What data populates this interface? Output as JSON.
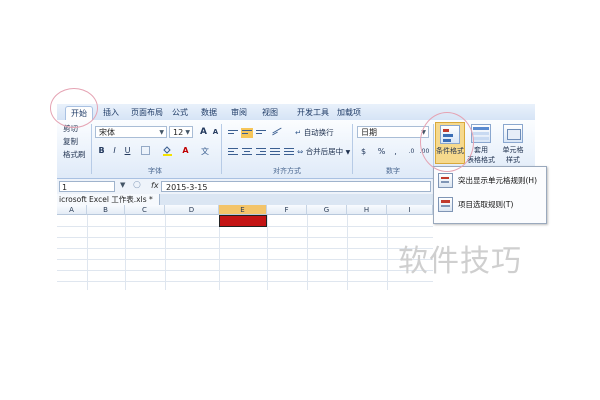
{
  "tabs": [
    "开始",
    "插入",
    "页面布局",
    "公式",
    "数据",
    "审阅",
    "视图",
    "开发工具",
    "加载项"
  ],
  "clipboard": {
    "cut": "剪切",
    "copy": "复制",
    "format_painter": "格式刷"
  },
  "font": {
    "name": "宋体",
    "size": "12",
    "grow": "A",
    "shrink": "A",
    "bold": "B",
    "italic": "I",
    "underline": "U",
    "font_color": "A",
    "group_label": "字体"
  },
  "alignment": {
    "wrap_text": "自动换行",
    "merge_center": "合并后居中",
    "group_label": "对齐方式"
  },
  "number": {
    "format": "日期",
    "currency": "$",
    "percent": "%",
    "comma": ",",
    "group_label": "数字"
  },
  "styles": {
    "conditional_formatting": "条件格式",
    "format_as_table_line1": "套用",
    "format_as_table_line2": "表格格式",
    "cell_styles_line1": "单元格",
    "cell_styles_line2": "样式"
  },
  "formula_bar": {
    "name_box": "1",
    "fx": "fx",
    "value": "2015-3-15"
  },
  "workbook_tab": "icrosoft Excel 工作表.xls *",
  "columns": [
    "A",
    "B",
    "C",
    "D",
    "E",
    "F",
    "G",
    "H",
    "I"
  ],
  "selected_column": "E",
  "dropdown_menu": [
    {
      "label": "突出显示单元格规则(H)"
    },
    {
      "label": "项目选取规则(T)"
    }
  ],
  "watermark": "软件技巧",
  "colors": {
    "selected_cell": "#c41414",
    "ribbon_bg": "#dfeaf8",
    "highlight_circle": "#e5a3b3"
  }
}
